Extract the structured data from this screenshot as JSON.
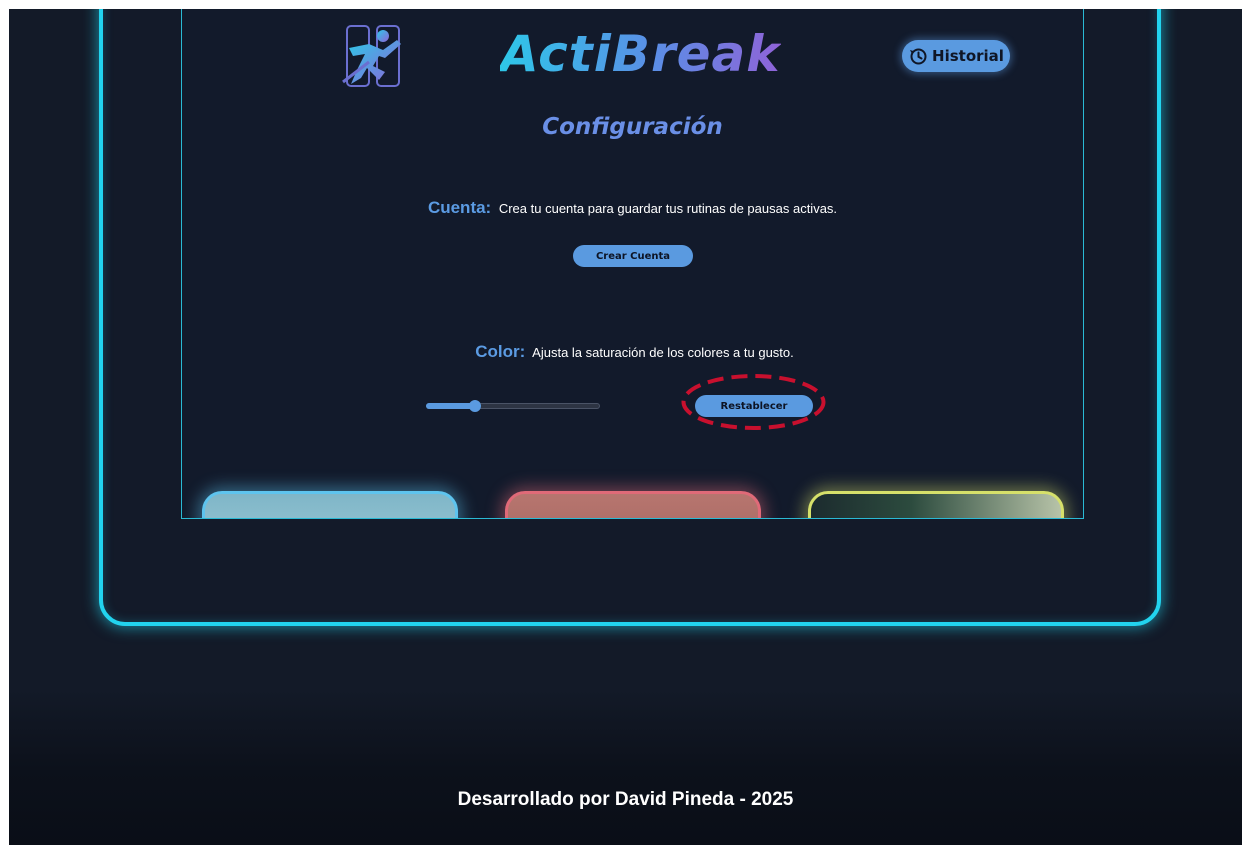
{
  "app": {
    "brand_title": "ActiBreak",
    "logo_icon": "running-person-logo-icon",
    "historial_label": "Historial",
    "historial_icon": "history-clock-icon"
  },
  "page": {
    "heading": "Configuración"
  },
  "cuenta": {
    "label": "Cuenta:",
    "description": "Crea tu cuenta para guardar tus rutinas de pausas activas.",
    "button_label": "Crear Cuenta"
  },
  "color": {
    "label": "Color:",
    "description": "Ajusta la saturación de los colores a tu gusto.",
    "saturation_slider_fraction": 0.28,
    "reset_button_label": "Restablecer"
  },
  "cards": [
    {
      "accent": "#5ec4ee"
    },
    {
      "accent": "#e06a78"
    },
    {
      "accent": "#d6e06a"
    }
  ],
  "footer": {
    "text": "Desarrollado por David Pineda - 2025"
  },
  "colors": {
    "accent_cyan": "#22d3ee",
    "button_blue": "#5a9ae0",
    "annotation_red": "#c8102e",
    "background": "#131a28"
  }
}
